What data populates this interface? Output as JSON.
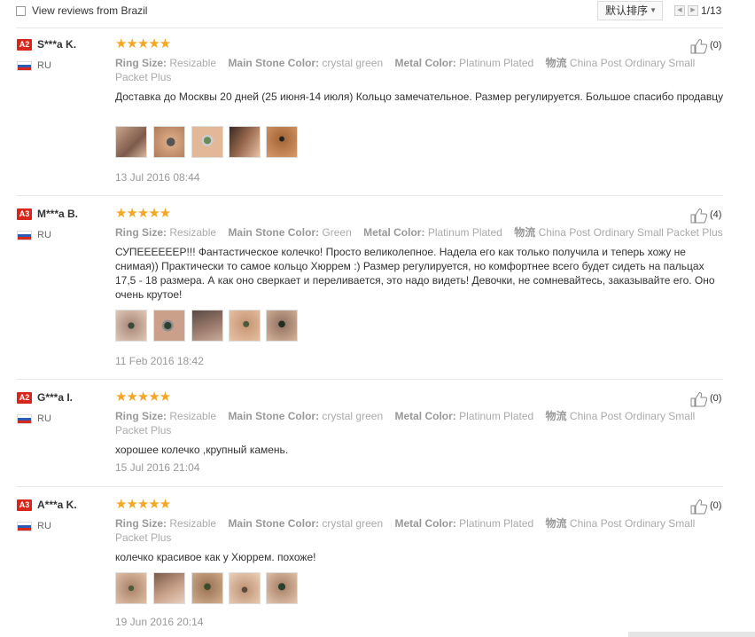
{
  "filter": {
    "label": "View reviews from Brazil"
  },
  "sort": {
    "label": "默认排序"
  },
  "pagination": {
    "text": "1/13"
  },
  "labels": {
    "ring_size": "Ring Size:",
    "stone_color": "Main Stone Color:",
    "metal_color": "Metal Color:",
    "logistics": "物流"
  },
  "reviews": [
    {
      "level": "A2",
      "name": "S***a K.",
      "country": "RU",
      "likes": "(0)",
      "ring_size": "Resizable",
      "stone_color": "crystal green",
      "metal_color": "Platinum Plated",
      "logistics": "China Post Ordinary Small Packet Plus",
      "text": "Доставка до Москвы 20 дней (25 июня-14 июля) Кольцо замечательное. Размер регулируется. Большое спасибо продавцу",
      "date": "13 Jul 2016 08:44",
      "photos": 5
    },
    {
      "level": "A3",
      "name": "M***a B.",
      "country": "RU",
      "likes": "(4)",
      "ring_size": "Resizable",
      "stone_color": "Green",
      "metal_color": "Platinum Plated",
      "logistics": "China Post Ordinary Small Packet Plus",
      "text": "СУПЕЕЕЕЕЕР!!! Фантастическое колечко! Просто великолепное. Надела его как только получила и теперь хожу не снимая)) Практически то самое кольцо Хюррем :) Размер регулируется, но комфортнее всего будет сидеть на пальцах 17,5 - 18 размера. А как оно сверкает и переливается, это надо видеть! Девочки, не сомневайтесь, заказывайте его. Оно очень крутое!",
      "date": "11 Feb 2016 18:42",
      "photos": 5
    },
    {
      "level": "A2",
      "name": "G***a I.",
      "country": "RU",
      "likes": "(0)",
      "ring_size": "Resizable",
      "stone_color": "crystal green",
      "metal_color": "Platinum Plated",
      "logistics": "China Post Ordinary Small Packet Plus",
      "text": "хорошее колечко ,крупный камень.",
      "date": "15 Jul 2016 21:04",
      "photos": 0
    },
    {
      "level": "A3",
      "name": "A***a K.",
      "country": "RU",
      "likes": "(0)",
      "ring_size": "Resizable",
      "stone_color": "crystal green",
      "metal_color": "Platinum Plated",
      "logistics": "China Post Ordinary Small Packet Plus",
      "text": "колечко красивое как у Хюррем. похоже!",
      "date": "19 Jun 2016 20:14",
      "photos": 5
    }
  ]
}
